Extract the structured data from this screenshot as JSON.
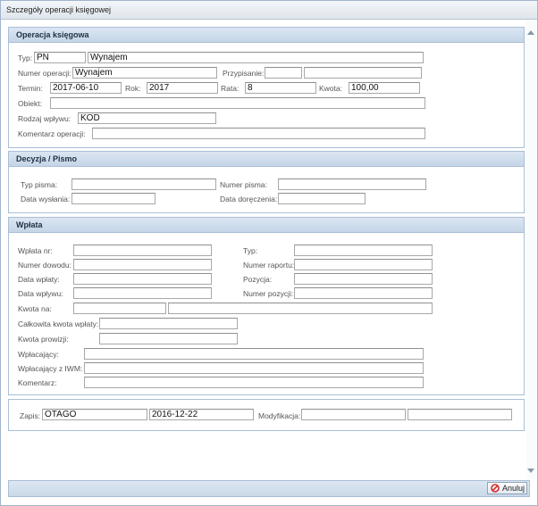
{
  "window": {
    "title": "Szczegóły operacji księgowej"
  },
  "operacja": {
    "header": "Operacja księgowa",
    "typ_label": "Typ:",
    "typ_code": "PN",
    "typ_name": "Wynajem",
    "numer_label": "Numer operacji:",
    "numer_value": "Wynajem",
    "przypisanie_label": "Przypisanie:",
    "przypisanie_1": "",
    "przypisanie_2": "",
    "termin_label": "Termin:",
    "termin_value": "2017-06-10",
    "rok_label": "Rok:",
    "rok_value": "2017",
    "rata_label": "Rata:",
    "rata_value": "8",
    "kwota_label": "Kwota:",
    "kwota_value": "100,00",
    "obiekt_label": "Obiekt:",
    "obiekt_value": "",
    "rodzaj_label": "Rodzaj wpływu:",
    "rodzaj_value": "KOD",
    "komentarz_label": "Komentarz operacji:",
    "komentarz_value": ""
  },
  "decyzja": {
    "header": "Decyzja / Pismo",
    "typ_pisma_label": "Typ pisma:",
    "typ_pisma_value": "",
    "numer_pisma_label": "Numer pisma:",
    "numer_pisma_value": "",
    "data_wyslania_label": "Data wysłania:",
    "data_wyslania_value": "",
    "data_doreczenia_label": "Data doręczenia:",
    "data_doreczenia_value": ""
  },
  "wplata": {
    "header": "Wpłata",
    "wplata_nr_label": "Wpłata nr:",
    "wplata_nr_value": "",
    "typ_label": "Typ:",
    "typ_value": "",
    "numer_dowodu_label": "Numer dowodu:",
    "numer_dowodu_value": "",
    "numer_raportu_label": "Numer raportu:",
    "numer_raportu_value": "",
    "data_wplaty_label": "Data wpłaty:",
    "data_wplaty_value": "",
    "pozycja_label": "Pozycja:",
    "pozycja_value": "",
    "data_wplywu_label": "Data wpływu:",
    "data_wplywu_value": "",
    "numer_pozycji_label": "Numer pozycji:",
    "numer_pozycji_value": "",
    "kwota_na_label": "Kwota na:",
    "kwota_na_1": "",
    "kwota_na_2": "",
    "calkowita_label": "Całkowita kwota wpłaty:",
    "calkowita_value": "",
    "prowizji_label": "Kwota prowizji:",
    "prowizji_value": "",
    "wplacajacy_label": "Wpłacający:",
    "wplacajacy_value": "",
    "wplacajacy_iwm_label": "Wpłacający z IWM:",
    "wplacajacy_iwm_value": "",
    "komentarz_label": "Komentarz:",
    "komentarz_value": ""
  },
  "zapis": {
    "zapis_label": "Zapis:",
    "zapis_user": "OTAGO",
    "zapis_date": "2016-12-22",
    "modyfikacja_label": "Modyfikacja:",
    "modyfikacja_user": "",
    "modyfikacja_date": ""
  },
  "footer": {
    "cancel_label": "Anuluj",
    "cancel_icon": "cancel-icon",
    "cancel_icon_color": "#d62828"
  }
}
